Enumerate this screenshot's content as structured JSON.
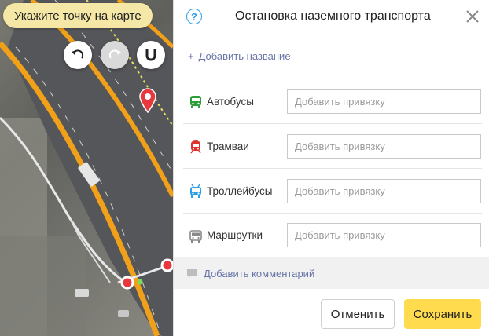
{
  "map": {
    "hint": "Укажите точку на карте",
    "controls": {
      "undo_icon": "undo-arrow-icon",
      "redo_icon": "redo-arrow-icon",
      "magnet_icon": "magnet-icon"
    }
  },
  "panel": {
    "title": "Остановка наземного транспорта",
    "add_name": "Добавить название",
    "add_name_prefix": "+",
    "rows": [
      {
        "label": "Автобусы",
        "placeholder": "Добавить привязку",
        "icon": "bus-icon",
        "color": "#2e9e3a"
      },
      {
        "label": "Трамваи",
        "placeholder": "Добавить привязку",
        "icon": "tram-icon",
        "color": "#e0322c"
      },
      {
        "label": "Троллейбусы",
        "placeholder": "Добавить привязку",
        "icon": "trolleybus-icon",
        "color": "#2a9ee8"
      },
      {
        "label": "Маршрутки",
        "placeholder": "Добавить привязку",
        "icon": "minibus-icon",
        "color": "#888888"
      }
    ],
    "comment": "Добавить комментарий",
    "cancel": "Отменить",
    "save": "Сохранить"
  },
  "colors": {
    "accent_yellow": "#ffdb4d",
    "link": "#6a75a8",
    "help_blue": "#2a9ee8",
    "pin_red": "#e8383d"
  }
}
